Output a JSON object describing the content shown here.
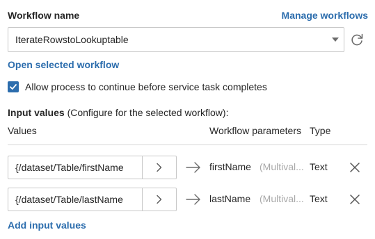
{
  "workflow": {
    "label": "Workflow name",
    "manage_link": "Manage workflows",
    "selected": "IterateRowstoLookuptable",
    "open_link": "Open selected workflow"
  },
  "allow_process": {
    "checked": true,
    "label": "Allow process to continue before service task completes"
  },
  "input_values": {
    "title_bold": "Input values",
    "title_rest": " (Configure for the selected workflow):",
    "col_values": "Values",
    "col_params": "Workflow parameters",
    "col_type": "Type",
    "rows": [
      {
        "value": "{/dataset/Table/firstName",
        "param": "firstName",
        "multi": "(Multival...",
        "type": "Text"
      },
      {
        "value": "{/dataset/Table/lastName",
        "param": "lastName",
        "multi": "(Multival...",
        "type": "Text"
      }
    ],
    "add_link": "Add input values"
  },
  "colors": {
    "accent": "#2c6dad",
    "muted": "#a8a8a8",
    "border": "#c8c8c8"
  },
  "icons": [
    "chevron-down-icon",
    "refresh-icon",
    "checkmark-icon",
    "chevron-right-icon",
    "arrow-right-icon",
    "close-icon"
  ]
}
